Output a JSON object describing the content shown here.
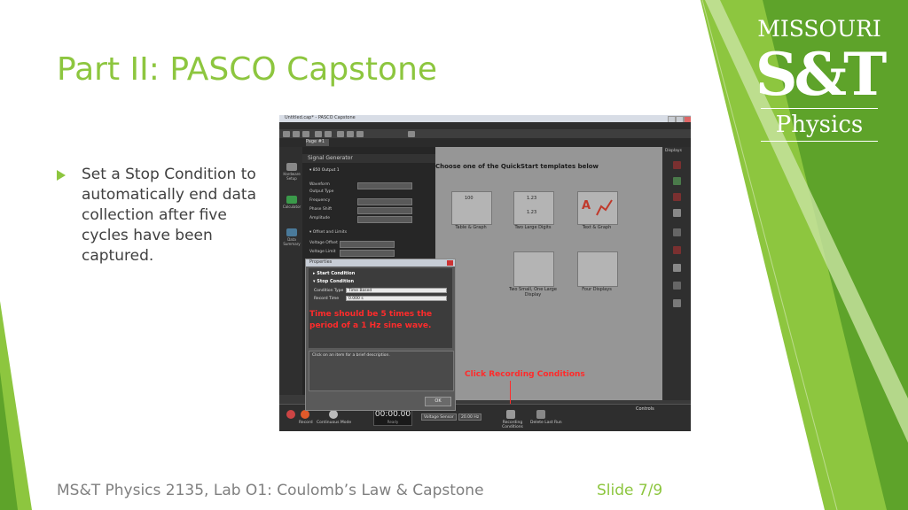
{
  "slide": {
    "title": "Part II: PASCO Capstone",
    "bullet": "Set a Stop Condition to automatically end data collection after five cycles have been captured.",
    "footer_left": "MS&T Physics 2135, Lab O1: Coulomb’s Law & Capstone",
    "footer_right": "Slide 7/9"
  },
  "logo": {
    "top": "MISSOURI",
    "mark": "S&T",
    "sub": "Physics"
  },
  "screenshot": {
    "window_title": "Untitled.cap* - PASCO Capstone",
    "tab_label": "Page #1",
    "hardware_header": "Signal Generator",
    "hardware_output": "▾ 850 Output 1",
    "hardware_rows": [
      "Waveform",
      "Output Type",
      "Frequency",
      "Phase Shift",
      "Amplitude",
      "▾ Offset and Limits",
      "Voltage Offset",
      "Voltage Limit"
    ],
    "main_heading": "Choose one of the QuickStart templates below",
    "templates": [
      "Table & Graph",
      "Two Large Digits",
      "Text & Graph",
      "",
      "Two Small, One Large Display",
      "Four Displays"
    ],
    "template_top_values": [
      "100",
      "1.23",
      "1.23"
    ],
    "dialog": {
      "title": "Properties",
      "start_condition": "▸ Start Condition",
      "stop_condition": "▾ Stop Condition",
      "condition_type_label": "Condition Type",
      "condition_type_value": "Time Based",
      "record_time_label": "Record Time",
      "record_time_value": "0.000 s",
      "annotation": "Time should be 5 times the period of a 1 Hz sine wave.",
      "description": "Click on an item for a brief description.",
      "ok_label": "OK"
    },
    "callout": "Click Recording Conditions",
    "controls": {
      "label": "Controls",
      "record": "Record",
      "mode": "Continuous Mode",
      "timer": "00:00.00",
      "timer_sub": "Ready",
      "sensor": "Voltage Sensor",
      "rate": "20.00 Hz",
      "recording_conditions": "Recording Conditions",
      "delete_last_run": "Delete Last Run"
    },
    "left_tools": [
      "Hardware Setup",
      "Calculator",
      "Data Summary"
    ],
    "right_tools": [
      "Displays"
    ]
  },
  "colors": {
    "accent_green": "#8dc63f",
    "dark_green": "#5ea32a",
    "annotation_red": "#ff2b2b"
  }
}
